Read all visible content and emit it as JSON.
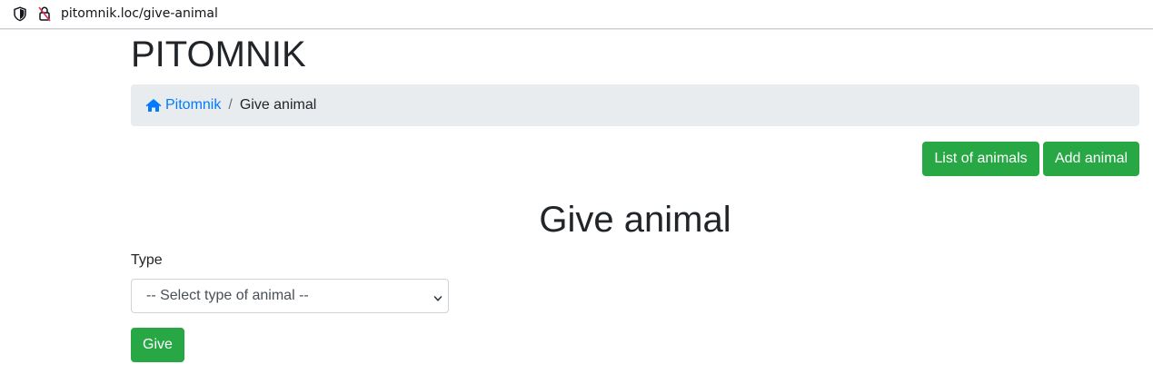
{
  "browser": {
    "url": "pitomnik.loc/give-animal"
  },
  "site": {
    "brand": "PITOMNIK"
  },
  "breadcrumb": {
    "home_label": "Pitomnik",
    "separator": "/",
    "current": "Give animal"
  },
  "actions": {
    "list_label": "List of animals",
    "add_label": "Add animal"
  },
  "page": {
    "heading": "Give animal"
  },
  "form": {
    "type_label": "Type",
    "type_select_value": "-- Select type of animal --",
    "submit_label": "Give"
  },
  "colors": {
    "accent_green": "#28a745",
    "link_blue": "#007bff",
    "breadcrumb_bg": "#e9ecef"
  }
}
